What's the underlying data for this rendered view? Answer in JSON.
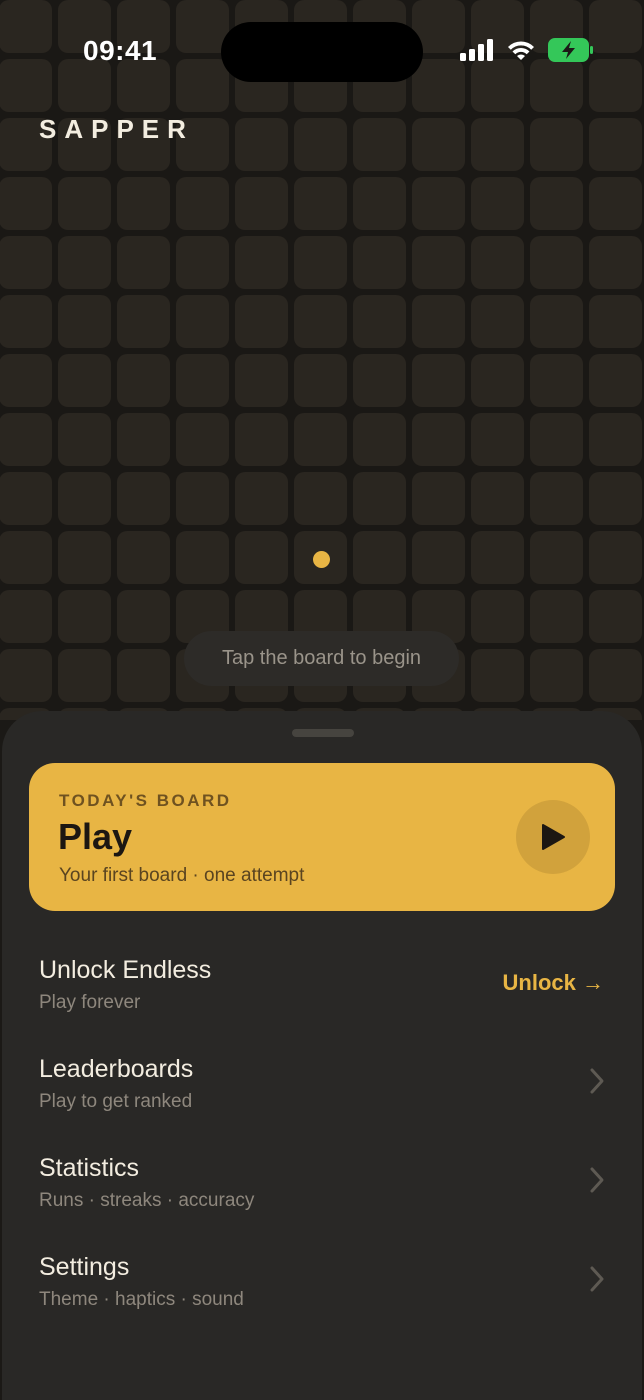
{
  "status_bar": {
    "time": "09:41",
    "icons": [
      "cellular-signal-icon",
      "wifi-icon",
      "battery-charging-icon"
    ]
  },
  "app": {
    "brand": "SAPPER"
  },
  "board": {
    "hint": "Tap the board to begin"
  },
  "sheet": {
    "play_card": {
      "eyebrow": "TODAY'S BOARD",
      "title": "Play",
      "subtitle": "Your first board · one attempt"
    },
    "menu": [
      {
        "title": "Unlock Endless",
        "subtitle": "Play forever",
        "action": "Unlock →"
      },
      {
        "title": "Leaderboards",
        "subtitle": "Play to get ranked"
      },
      {
        "title": "Statistics",
        "subtitle": "Runs · streaks · accuracy"
      },
      {
        "title": "Settings",
        "subtitle": "Theme · haptics · sound"
      }
    ]
  },
  "colors": {
    "accent": "#e8b544",
    "background": "#1b1916",
    "sheet": "#292826",
    "tile": "#2a2620"
  }
}
